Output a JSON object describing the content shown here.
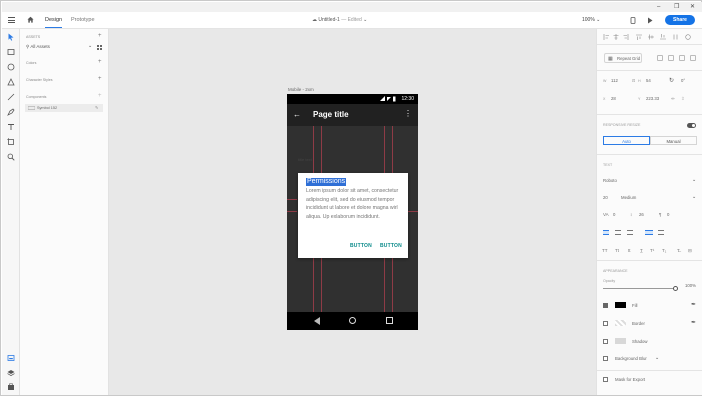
{
  "window": {
    "minimize": "–",
    "restore": "❐",
    "close": "✕"
  },
  "header": {
    "tabs": [
      {
        "label": "Design"
      },
      {
        "label": "Prototype"
      }
    ],
    "doc_title": "Untitled-1",
    "doc_status": "Edited",
    "zoom": "100%",
    "share_label": "Share"
  },
  "assets": {
    "title": "ASSETS",
    "filter": "All Assets",
    "sections": [
      {
        "label": "Colors"
      },
      {
        "label": "Character Styles"
      },
      {
        "label": "Components"
      }
    ],
    "symbol_label": "Symbol 152"
  },
  "canvas": {
    "artboard_label": "Mobile - 2xm",
    "status_time": "12:30",
    "page_title": "Page title",
    "ghost_text": "title text",
    "dialog": {
      "title": "Permissions",
      "body": "Lorem ipsum dolor sit amet, consectetur adipiscing elit, sed do eiusmod tempor incididunt ut labore et dolore magna wirl aliqua. Up exlaborum incididunt.",
      "button1": "BUTTON",
      "button2": "BUTTON"
    }
  },
  "props": {
    "repeat_grid": "Repeat Grid",
    "w_label": "W",
    "w_value": "112",
    "h_label": "H",
    "h_value": "54",
    "x_label": "X",
    "x_value": "28",
    "y_label": "Y",
    "y_value": "223.33",
    "rotation_value": "0°",
    "responsive_label": "RESPONSIVE RESIZE",
    "auto_label": "Auto",
    "manual_label": "Manual",
    "text_label": "TEXT",
    "font_family": "Roboto",
    "font_size": "20",
    "font_weight": "Medium",
    "char_spacing": "0",
    "line_spacing": "26",
    "para_spacing": "0",
    "appearance_label": "APPEARANCE",
    "opacity_label": "Opacity",
    "opacity_value": "100%",
    "fill_label": "Fill",
    "border_label": "Border",
    "shadow_label": "Shadow",
    "bg_blur_label": "Background Blur",
    "mask_label": "Mask for Export"
  },
  "colors": {
    "accent": "#1473e6",
    "dialog_title_highlight": "#2f6fd6",
    "button_text": "#0a8a8a",
    "fill_swatch": "#000000"
  }
}
